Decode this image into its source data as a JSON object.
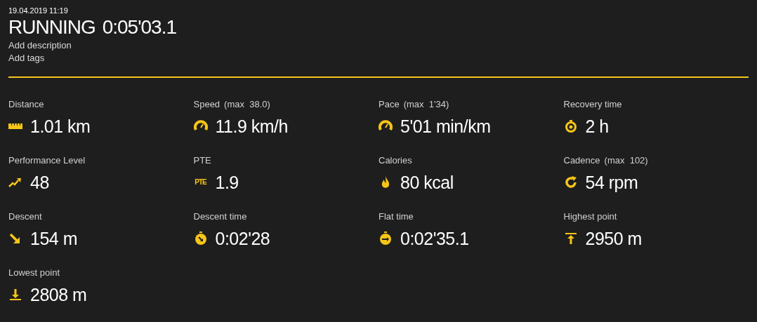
{
  "header": {
    "date": "19.04.2019 11:19",
    "title": "RUNNING",
    "duration": "0:05'03.1",
    "links": [
      "Add description",
      "Add tags"
    ]
  },
  "metrics": [
    {
      "label": "Distance",
      "value": "1.01 km"
    },
    {
      "label": "Speed",
      "max": "(max  38.0)",
      "value": "11.9 km/h"
    },
    {
      "label": "Pace",
      "max": "(max  1'34)",
      "value": "5'01 min/km"
    },
    {
      "label": "Recovery time",
      "value": "2 h"
    },
    {
      "label": "Performance Level",
      "value": "48"
    },
    {
      "label": "PTE",
      "icon_text": "PTE",
      "value": "1.9"
    },
    {
      "label": "Calories",
      "value": "80 kcal"
    },
    {
      "label": "Cadence",
      "max": "(max  102)",
      "value": "54 rpm"
    },
    {
      "label": "Descent",
      "value": "154 m"
    },
    {
      "label": "Descent time",
      "value": "0:02'28"
    },
    {
      "label": "Flat time",
      "value": "0:02'35.1"
    },
    {
      "label": "Highest point",
      "value": "2950 m"
    },
    {
      "label": "Lowest point",
      "value": "2808 m"
    }
  ]
}
